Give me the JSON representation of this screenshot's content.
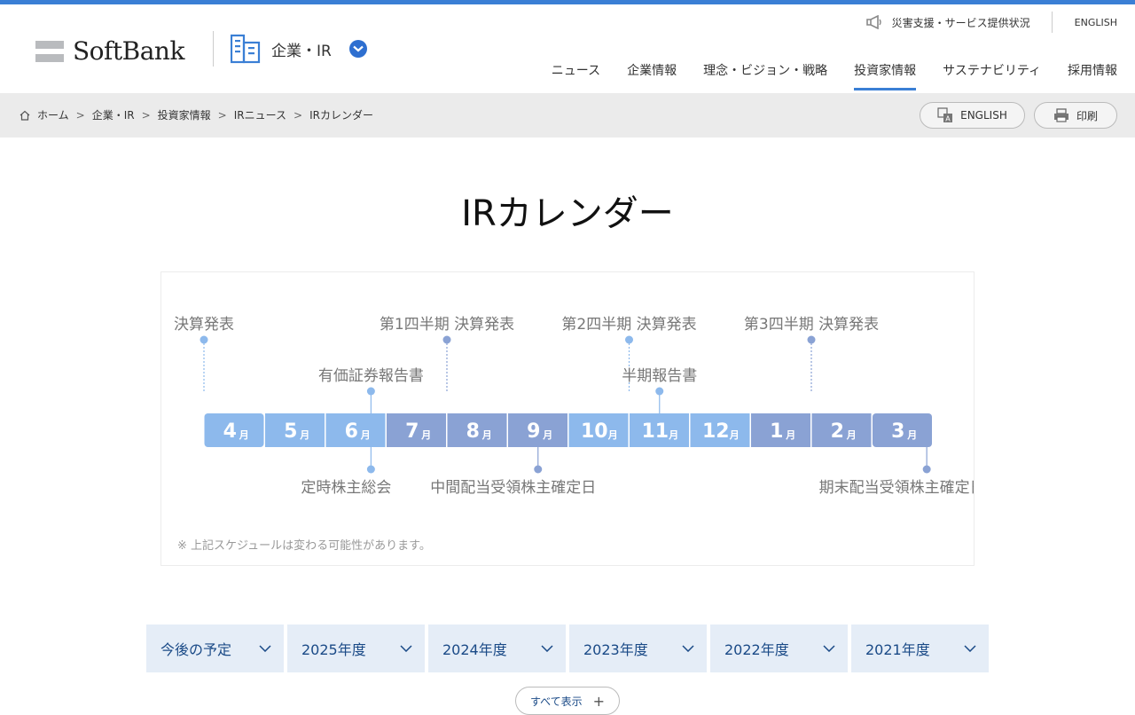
{
  "header": {
    "logo_text": "SoftBank",
    "section_title": "企業・IR",
    "util": {
      "alert_link": "災害支援・サービス提供状況",
      "english": "ENGLISH"
    },
    "nav": [
      {
        "label": "ニュース"
      },
      {
        "label": "企業情報"
      },
      {
        "label": "理念・ビジョン・戦略"
      },
      {
        "label": "投資家情報",
        "active": true
      },
      {
        "label": "サステナビリティ"
      },
      {
        "label": "採用情報"
      }
    ]
  },
  "breadcrumb": {
    "items": [
      "ホーム",
      "企業・IR",
      "投資家情報",
      "IRニュース",
      "IRカレンダー"
    ],
    "separator": ">",
    "english_button": "ENGLISH",
    "print_button": "印刷"
  },
  "page_title": "IRカレンダー",
  "calendar": {
    "months": [
      {
        "num": "4",
        "unit": "月",
        "tone": "light"
      },
      {
        "num": "5",
        "unit": "月",
        "tone": "light"
      },
      {
        "num": "6",
        "unit": "月",
        "tone": "light"
      },
      {
        "num": "7",
        "unit": "月",
        "tone": "dark"
      },
      {
        "num": "8",
        "unit": "月",
        "tone": "dark"
      },
      {
        "num": "9",
        "unit": "月",
        "tone": "dark"
      },
      {
        "num": "10",
        "unit": "月",
        "tone": "light"
      },
      {
        "num": "11",
        "unit": "月",
        "tone": "light"
      },
      {
        "num": "12",
        "unit": "月",
        "tone": "light"
      },
      {
        "num": "1",
        "unit": "月",
        "tone": "dark"
      },
      {
        "num": "2",
        "unit": "月",
        "tone": "dark"
      },
      {
        "num": "3",
        "unit": "月",
        "tone": "dark"
      }
    ],
    "events_top": [
      {
        "label": "決算発表",
        "month_index": 0,
        "position": 0.0,
        "tone": "light",
        "level": "high"
      },
      {
        "label": "第1四半期 決算発表",
        "month_index": 3,
        "position": 1.0,
        "tone": "dark",
        "level": "high"
      },
      {
        "label": "第2四半期 決算発表",
        "month_index": 6,
        "position": 1.0,
        "tone": "light",
        "level": "high"
      },
      {
        "label": "第3四半期 決算発表",
        "month_index": 9,
        "position": 1.0,
        "tone": "dark",
        "level": "high"
      },
      {
        "label": "有価証券報告書",
        "month_index": 2,
        "position": 0.75,
        "tone": "light",
        "level": "mid"
      },
      {
        "label": "半期報告書",
        "month_index": 7,
        "position": 0.5,
        "tone": "light",
        "level": "mid"
      }
    ],
    "events_bottom": [
      {
        "label": "定時株主総会",
        "month_index": 2,
        "position": 0.75,
        "tone": "light"
      },
      {
        "label": "中間配当受領株主確定日",
        "month_index": 5,
        "position": 0.5,
        "tone": "dark"
      },
      {
        "label": "期末配当受領株主確定日",
        "month_index": 11,
        "position": 0.9,
        "tone": "dark"
      }
    ],
    "note": "※ 上記スケジュールは変わる可能性があります。",
    "colors": {
      "light": "#8db9ec",
      "dark": "#8aa2d4",
      "text": "#777777",
      "label": "#ffffff"
    }
  },
  "tabs": [
    {
      "label": "今後の予定"
    },
    {
      "label": "2025年度"
    },
    {
      "label": "2024年度"
    },
    {
      "label": "2023年度"
    },
    {
      "label": "2022年度"
    },
    {
      "label": "2021年度"
    }
  ],
  "show_all": "すべて表示"
}
